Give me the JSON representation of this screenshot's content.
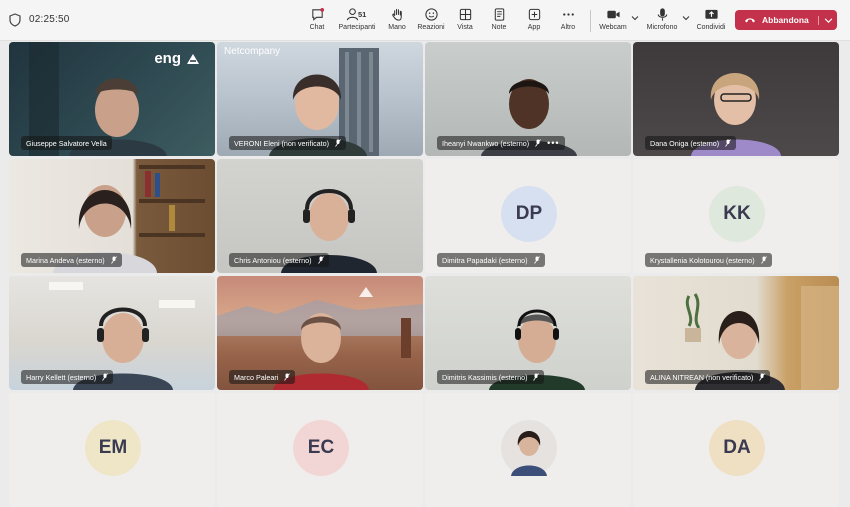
{
  "call": {
    "timer": "02:25:50"
  },
  "toolbar": {
    "chat": "Chat",
    "participants": "Partecipanti",
    "participants_count": "51",
    "raise_hand": "Mano",
    "reactions": "Reazioni",
    "view": "Vista",
    "notes": "Note",
    "apps": "App",
    "more": "Altro",
    "webcam": "Webcam",
    "mic": "Microfono",
    "share": "Condividi",
    "leave": "Abbandona"
  },
  "tiles": [
    {
      "name": "Giuseppe Salvatore Vella",
      "logo": "eng"
    },
    {
      "name": "VERONI Eleni (non verificato)",
      "logo": "Netcompany"
    },
    {
      "name": "Iheanyi Nwankwo (esterno)",
      "more": "•••"
    },
    {
      "name": "Dana Oniga (esterno)"
    },
    {
      "name": "Marina Andeva (esterno)"
    },
    {
      "name": "Chris Antoniou (esterno)"
    },
    {
      "name": "Dimitra Papadaki (esterno)",
      "initials": "DP"
    },
    {
      "name": "Krystallenia Kolotourou (esterno)",
      "initials": "KK"
    },
    {
      "name": "Harry Kellett (esterno)"
    },
    {
      "name": "Marco Paleari"
    },
    {
      "name": "Dimitris Kassimis (esterno)"
    },
    {
      "name": "ALINA NITREAN (non verificato)"
    },
    {
      "initials": "EM"
    },
    {
      "initials": "EC"
    },
    {},
    {
      "initials": "DA"
    }
  ],
  "colors": {
    "leave": "#c4314b",
    "avatar_bg": "#dde3f0"
  }
}
